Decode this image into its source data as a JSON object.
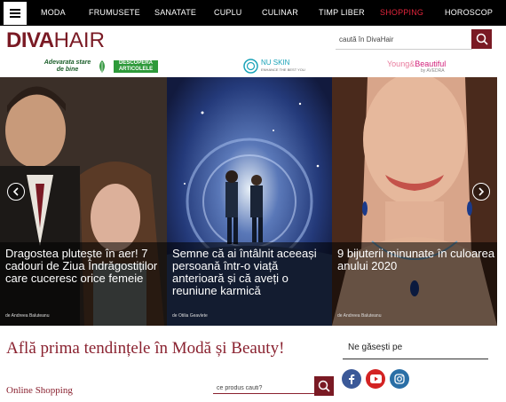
{
  "nav": {
    "items": [
      {
        "label": "MODA",
        "active": false
      },
      {
        "label": "FRUMUSETE",
        "active": false
      },
      {
        "label": "SANATATE",
        "active": false
      },
      {
        "label": "CUPLU",
        "active": false
      },
      {
        "label": "CULINAR",
        "active": false
      },
      {
        "label": "TIMP LIBER",
        "active": false
      },
      {
        "label": "SHOPPING",
        "active": true
      },
      {
        "label": "HOROSCOP",
        "active": false
      }
    ]
  },
  "header": {
    "logo_bold": "DIVA",
    "logo_light": "HAIR",
    "search_placeholder": "caută în DivaHair"
  },
  "sponsors": {
    "s1_text": "Adevarata stare de bine",
    "s1_button": "DESCOPERA ARTICOLELE",
    "s2_name": "NU SKIN",
    "s2_sub": "ENHANCE THE BEST YOU",
    "s3_young": "Young",
    "s3_amp": "&",
    "s3_beautiful": "Beautiful",
    "s3_sub": "by AVEDRA"
  },
  "slider": {
    "slides": [
      {
        "title": "Dragostea plutește în aer! 7 cadouri de Ziua Îndrăgostiților care cuceresc orice femeie",
        "author": "de Andreea Baluteanu"
      },
      {
        "title": "Semne că ai întâlnit aceeași persoană într-o viață anterioară și că aveți o reuniune karmică",
        "author": "de Otilia Geavlete"
      },
      {
        "title": "9 bijuterii minunate în culoarea anului 2020",
        "author": "de Andreea Baluteanu"
      }
    ]
  },
  "bottom": {
    "title": "Află prima tendințele în Modă și Beauty!",
    "online_shopping": "Online Shopping",
    "product_search_placeholder": "ce produs cauti?",
    "find_us": "Ne găsești pe"
  },
  "colors": {
    "brand": "#7a1a24",
    "nav_active": "#e0243b"
  }
}
